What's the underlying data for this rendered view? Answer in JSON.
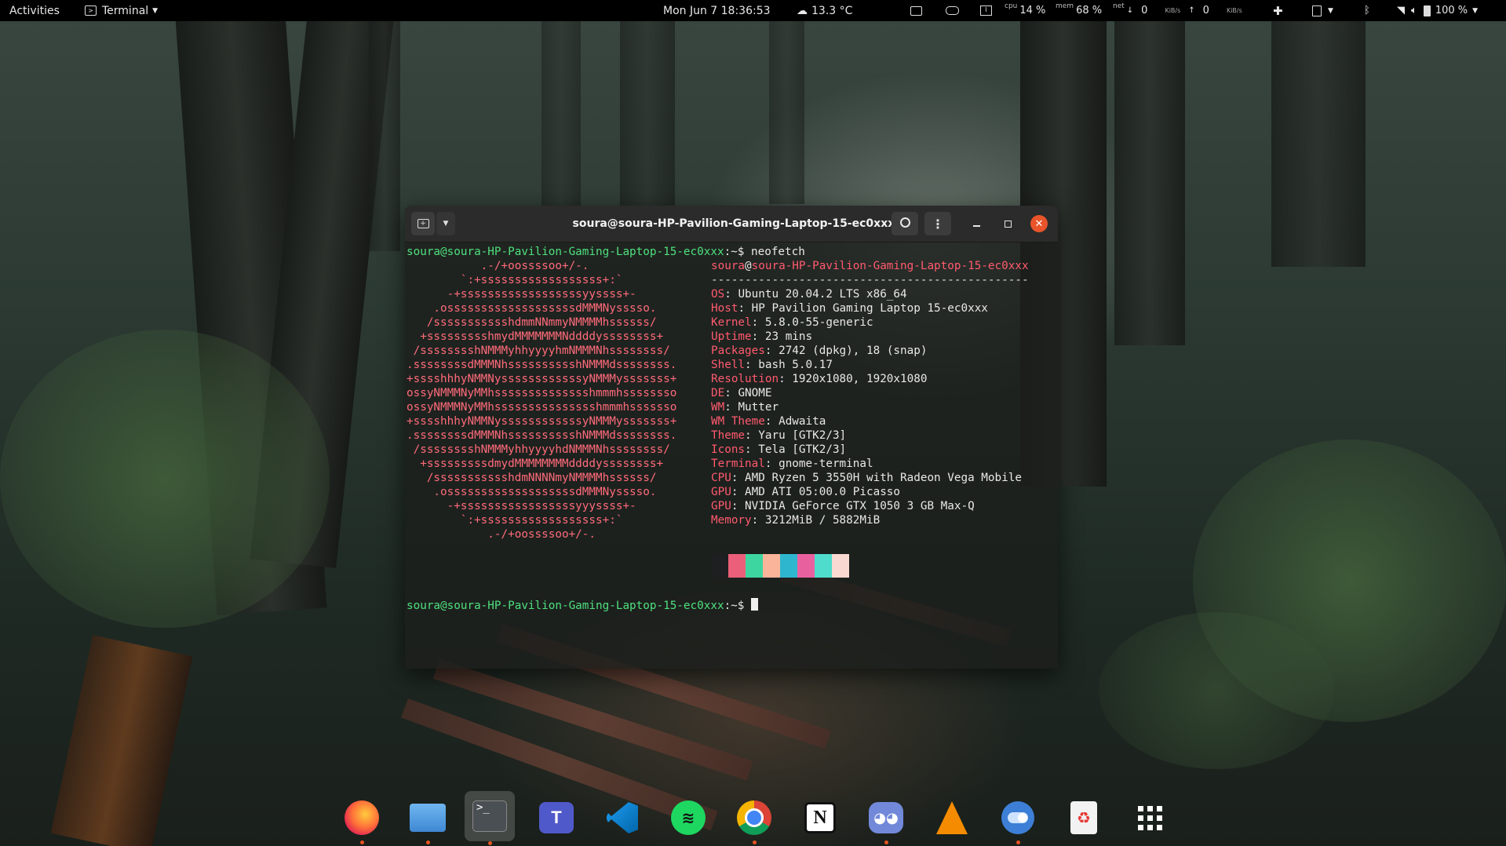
{
  "topbar": {
    "activities": "Activities",
    "app_name": "Terminal",
    "clock": "Mon Jun 7  18:36:53",
    "weather": "13.3 °C",
    "cpu_label": "cpu",
    "cpu_value": "14 %",
    "mem_label": "mem",
    "mem_value": "68 %",
    "net_label": "net",
    "net_down": "0",
    "net_up": "0",
    "net_unit": "KiB/s",
    "battery": "100 %"
  },
  "terminal": {
    "title": "soura@soura-HP-Pavilion-Gaming-Laptop-15-ec0xxx: ~",
    "prompt_user": "soura@soura-HP-Pavilion-Gaming-Laptop-15-ec0xxx",
    "prompt_suffix": ":~$ ",
    "command": "neofetch",
    "ascii_art": [
      "           .-/+oossssoo+/-.",
      "        `:+ssssssssssssssssss+:`",
      "      -+ssssssssssssssssssyyssss+-",
      "    .osssssssssssssssssssdMMMNysssso.",
      "   /ssssssssssshdmmNNmmyNMMMMhssssss/",
      "  +ssssssssshmydMMMMMMMNddddyssssssss+",
      " /sssssssshNMMMyhhyyyyhmNMMMNhssssssss/",
      ".ssssssssdMMMNhsssssssssshNMMMdssssssss.",
      "+sssshhhyNMMNyssssssssssssyNMMMysssssss+",
      "ossyNMMMNyMMhsssssssssssssshmmmhssssssso",
      "ossyNMMMNyMMhssssssssssssssshmmmhsssssso",
      "+sssshhhyNMMNyssssssssssssyNMMMysssssss+",
      ".ssssssssdMMMNhsssssssssshNMMMdssssssss.",
      " /sssssssshNMMMyhhyyyyhdNMMMNhssssssss/",
      "  +sssssssssdmydMMMMMMMMddddyssssssss+",
      "   /ssssssssssshdmNNNNmyNMMMMhssssss/",
      "    .osssssssssssssssssssdMMMNysssso.",
      "      -+sssssssssssssssssyyyssss+-",
      "        `:+ssssssssssssssssss+:`",
      "            .-/+oossssoo+/-."
    ],
    "info_user": "soura",
    "info_host": "soura-HP-Pavilion-Gaming-Laptop-15-ec0xxx",
    "separator": "-----------------------------------------------",
    "info": [
      {
        "key": "OS",
        "value": "Ubuntu 20.04.2 LTS x86_64"
      },
      {
        "key": "Host",
        "value": "HP Pavilion Gaming Laptop 15-ec0xxx"
      },
      {
        "key": "Kernel",
        "value": "5.8.0-55-generic"
      },
      {
        "key": "Uptime",
        "value": "23 mins"
      },
      {
        "key": "Packages",
        "value": "2742 (dpkg), 18 (snap)"
      },
      {
        "key": "Shell",
        "value": "bash 5.0.17"
      },
      {
        "key": "Resolution",
        "value": "1920x1080, 1920x1080"
      },
      {
        "key": "DE",
        "value": "GNOME"
      },
      {
        "key": "WM",
        "value": "Mutter"
      },
      {
        "key": "WM Theme",
        "value": "Adwaita"
      },
      {
        "key": "Theme",
        "value": "Yaru [GTK2/3]"
      },
      {
        "key": "Icons",
        "value": "Tela [GTK2/3]"
      },
      {
        "key": "Terminal",
        "value": "gnome-terminal"
      },
      {
        "key": "CPU",
        "value": "AMD Ryzen 5 3550H with Radeon Vega Mobile"
      },
      {
        "key": "GPU",
        "value": "AMD ATI 05:00.0 Picasso"
      },
      {
        "key": "GPU",
        "value": "NVIDIA GeForce GTX 1050 3 GB Max-Q"
      },
      {
        "key": "Memory",
        "value": "3212MiB / 5882MiB"
      }
    ],
    "palette": [
      "#1d1f21",
      "#ec5f7a",
      "#3ed6a0",
      "#f9b49a",
      "#2fb6cf",
      "#e9609f",
      "#4fdccc",
      "#f8d8d0"
    ]
  },
  "colors": {
    "prompt_green": "#4ee07e",
    "accent_red": "#ff5a6e",
    "close_button": "#e9542a"
  },
  "dock": {
    "items": [
      {
        "name": "firefox-icon",
        "running": true
      },
      {
        "name": "files-icon",
        "running": true
      },
      {
        "name": "terminal-icon",
        "running": true
      },
      {
        "name": "teams-icon",
        "running": false
      },
      {
        "name": "vscode-icon",
        "running": false
      },
      {
        "name": "spotify-icon",
        "running": false
      },
      {
        "name": "chrome-icon",
        "running": true
      },
      {
        "name": "notion-icon",
        "running": false
      },
      {
        "name": "discord-icon",
        "running": true
      },
      {
        "name": "vlc-icon",
        "running": false
      },
      {
        "name": "toggle-app-icon",
        "running": true
      },
      {
        "name": "recycle-app-icon",
        "running": false
      },
      {
        "name": "show-applications-icon",
        "running": false
      }
    ]
  }
}
